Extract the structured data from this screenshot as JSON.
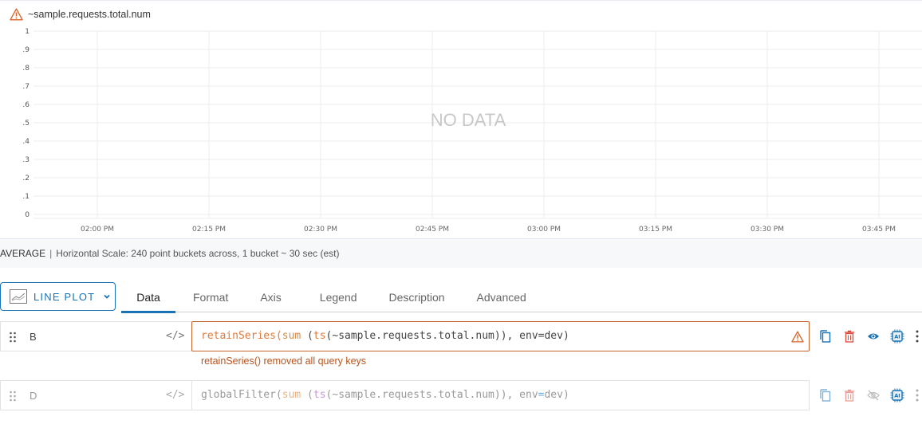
{
  "chart": {
    "title": "~sample.requests.total.num",
    "title_icon": "warning-triangle-icon",
    "no_data_label": "NO DATA",
    "colors": {
      "warning": "#d9662b",
      "grid": "#ececec",
      "no_data": "#c8c8c8",
      "accent": "#1a73b5"
    }
  },
  "chart_data": {
    "type": "line",
    "title": "~sample.requests.total.num",
    "xlabel": "",
    "ylabel": "",
    "series": [],
    "y_ticks": [
      "0",
      ".1",
      ".2",
      ".3",
      ".4",
      ".5",
      ".6",
      ".7",
      ".8",
      ".9",
      "1"
    ],
    "ylim": [
      0,
      1
    ],
    "x_ticks": [
      "02:00 PM",
      "02:15 PM",
      "02:30 PM",
      "02:45 PM",
      "03:00 PM",
      "03:15 PM",
      "03:30 PM",
      "03:45 PM"
    ],
    "grid": true,
    "annotation": "NO DATA"
  },
  "summary": {
    "mode": "AVERAGE",
    "separator": "|",
    "text": "Horizontal Scale: 240 point buckets across, 1 bucket ~ 30 sec (est)"
  },
  "toolbar": {
    "chart_type_label": "LINE PLOT",
    "chart_type_icon": "line-chart-icon",
    "tabs": [
      {
        "label": "Data",
        "active": true
      },
      {
        "label": "Format",
        "active": false
      },
      {
        "label": "Axis",
        "active": false
      },
      {
        "label": "Legend",
        "active": false
      },
      {
        "label": "Description",
        "active": false
      },
      {
        "label": "Advanced",
        "active": false
      }
    ]
  },
  "queries": [
    {
      "name": "B",
      "code_toggle": "</>",
      "expression_parts": {
        "fn": "retainSeries(",
        "fn2": "sum",
        "p1": " (",
        "ts": "ts",
        "p2": "(~sample.requests.total.num)), env",
        "eq": "=",
        "p3": "dev)"
      },
      "expression": "retainSeries(sum (ts(~sample.requests.total.num)), env=dev)",
      "has_warning": true,
      "error": "retainSeries() removed all query keys",
      "enabled": true
    },
    {
      "name": "D",
      "code_toggle": "</>",
      "expression_parts": {
        "fn": "globalFilter(",
        "fn2": "sum",
        "p1": " (",
        "ts": "ts",
        "p2": "(~sample.requests.total.num)), env",
        "eq": "=",
        "p3": "dev)"
      },
      "expression": "globalFilter(sum (ts(~sample.requests.total.num)), env=dev)",
      "has_warning": false,
      "enabled": false
    }
  ]
}
